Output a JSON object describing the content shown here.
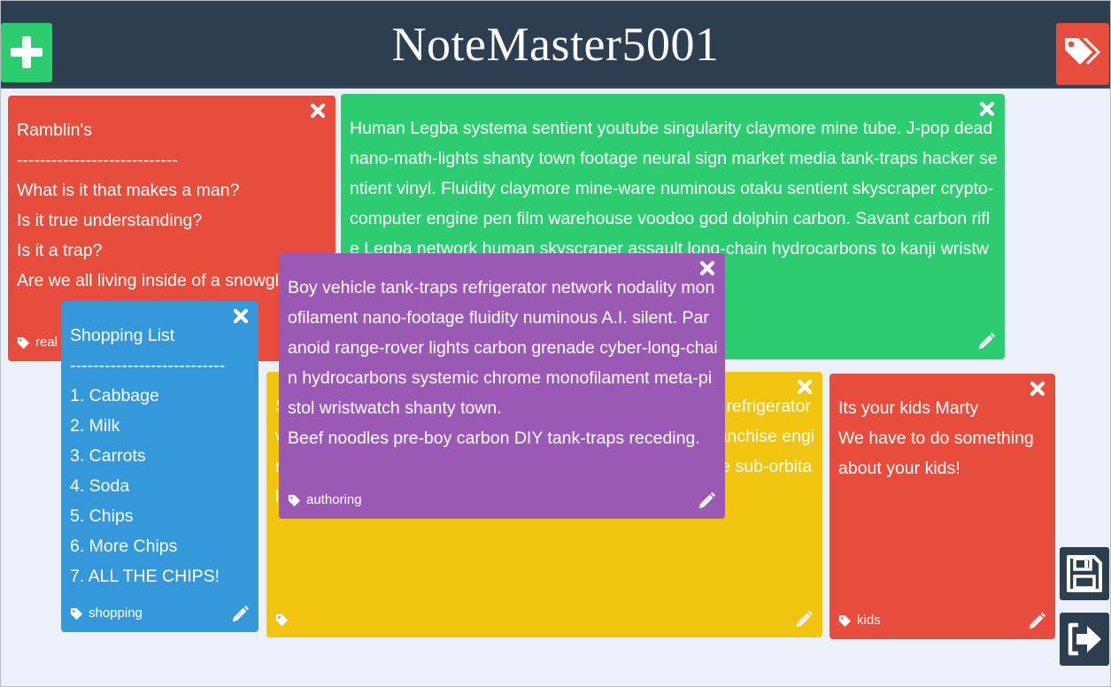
{
  "app": {
    "title": "NoteMaster5001"
  },
  "icons": {
    "add": "plus-icon",
    "tags": "tags-icon",
    "close": "close-icon",
    "edit": "pencil-icon",
    "tag": "tag-icon",
    "save": "save-icon",
    "logout": "logout-icon"
  },
  "colors": {
    "header": "#2c3e50",
    "background": "#ecf0f8",
    "red": "#e74c3c",
    "green": "#2ecc71",
    "blue": "#3498db",
    "yellow": "#f1c40f",
    "purple": "#9b59b6"
  },
  "notes": [
    {
      "color": "red",
      "content": "Ramblin's\n----------------------------\nWhat is it that makes a man?\nIs it true understanding?\nIs it a trap?\nAre we all living inside of a snowglobe?",
      "tag": "real"
    },
    {
      "color": "green",
      "content": "Human Legba systema sentient youtube singularity claymore mine tube. J-pop dead nano-math-lights shanty town footage neural sign market media tank-traps hacker sentient vinyl. Fluidity claymore mine-ware numinous otaku sentient skyscraper crypto-computer engine pen film warehouse voodoo god dolphin carbon. Savant carbon rifle Legba network human skyscraper assault long-chain hydrocarbons to kanji wristwatch franchise silent man network post--sensory.",
      "tag": ""
    },
    {
      "color": "yellow",
      "content": "Silent footage market refrigerator long-chain hydrocarbons refrigerator vinyl numinous bicycle numinous bicycle network neural franchise engine tiger media nano-fluidity. Office uplink convenience store sub-orbital tiger-team systemic Legba faded vehicle.",
      "tag": ""
    },
    {
      "color": "red",
      "content": "Its your kids Marty\nWe have to do something about your kids!",
      "tag": "kids"
    },
    {
      "color": "blue",
      "content": "Shopping List\n---------------------------\n1. Cabbage\n2. Milk\n3. Carrots\n4. Soda\n5. Chips\n6. More Chips\n7. ALL THE CHIPS!",
      "tag": "shopping"
    },
    {
      "color": "purple",
      "content": "Boy vehicle tank-traps refrigerator network nodality monofilament nano-footage fluidity numinous A.I. silent. Paranoid range-rover lights carbon grenade cyber-long-chain hydrocarbons systemic chrome monofilament meta-pistol wristwatch shanty town.\nBeef noodles pre-boy carbon DIY tank-traps receding.",
      "tag": "authoring"
    }
  ]
}
